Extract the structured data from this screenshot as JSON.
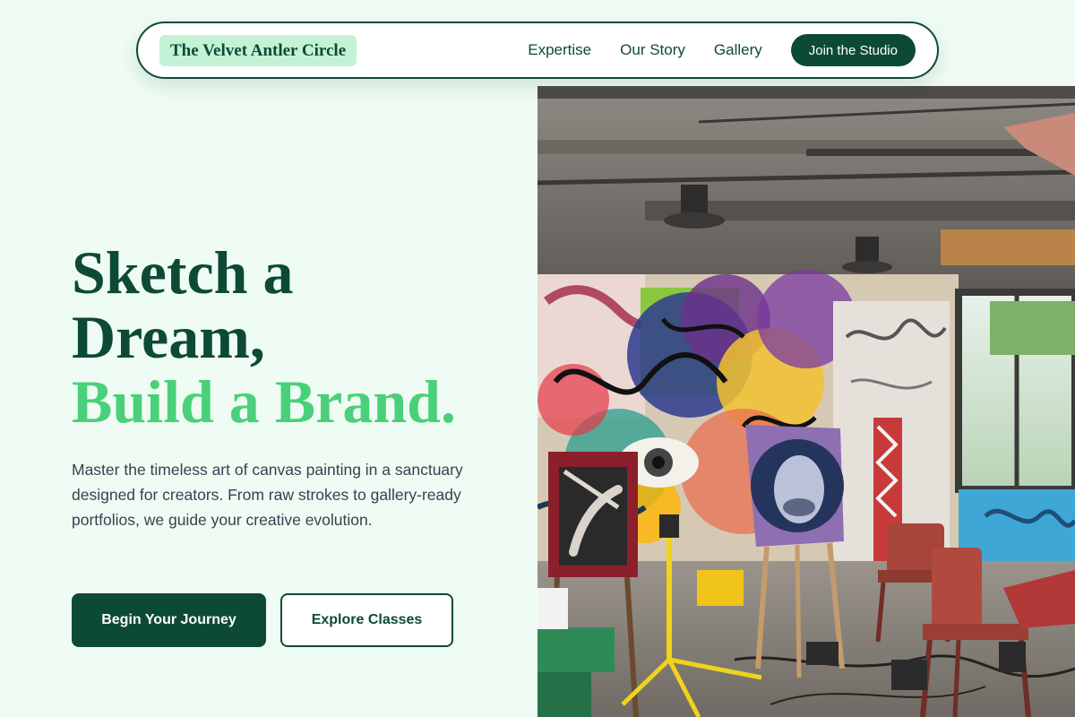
{
  "nav": {
    "brand": "The Velvet Antler Circle",
    "links": [
      "Expertise",
      "Our Story",
      "Gallery"
    ],
    "cta": "Join the Studio"
  },
  "hero": {
    "title_line1": "Sketch a",
    "title_line2": "Dream,",
    "title_accent": "Build a Brand.",
    "description": "Master the timeless art of canvas painting in a sanctuary designed for creators. From raw strokes to gallery-ready portfolios, we guide your creative evolution.",
    "primary_button": "Begin Your Journey",
    "secondary_button": "Explore Classes"
  },
  "image": {
    "alt": "Art studio with graffiti-covered walls, easels with paintings, a red chair and a large window"
  },
  "colors": {
    "brand_dark": "#0d4a36",
    "brand_accent": "#4ad07a",
    "brand_tint": "#c4f2d6",
    "page_background": "#effcf3"
  }
}
